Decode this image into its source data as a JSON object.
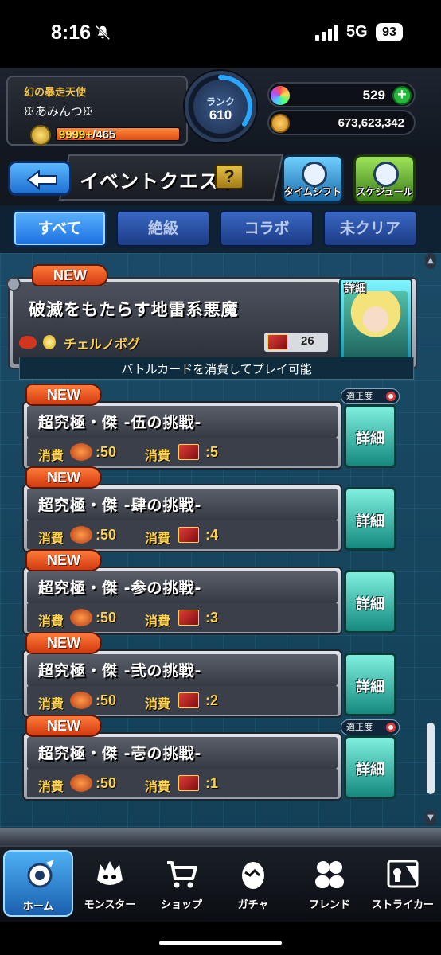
{
  "status_bar": {
    "time": "8:16",
    "network": "5G",
    "battery": "93"
  },
  "player": {
    "title": "幻の暴走天使",
    "name": "ꕥあみんつꕥ",
    "exp_text": "9999+",
    "exp_max": "/465",
    "exp_fraction": 1.0,
    "rank_label": "ランク",
    "rank_value": "610",
    "rank_progress": 0.35
  },
  "currency": {
    "gems": "529",
    "gold": "673,623,342"
  },
  "title_bar": {
    "title": "イベントクエスト",
    "help": "?",
    "timeshift_label": "タイムシフト",
    "schedule_label": "スケジュール"
  },
  "tabs": [
    {
      "label": "すべて",
      "active": true
    },
    {
      "label": "絶級",
      "active": false
    },
    {
      "label": "コラボ",
      "active": false
    },
    {
      "label": "未クリア",
      "active": false
    }
  ],
  "featured": {
    "badge": "NEW",
    "title": "破滅をもたらす地雷系悪魔",
    "boss_name": "チェルノボグ",
    "cards": "26",
    "detail_label": "詳細",
    "note": "バトルカードを消費してプレイ可能"
  },
  "quests": [
    {
      "badge": "NEW",
      "title": "超究極・傑 -伍の挑戦-",
      "cost_label": "消費",
      "stamina_label": "スタミナ",
      "stamina": ":50",
      "card_cost": ":5",
      "detail_label": "詳細",
      "suitability": "適正度",
      "show_suit": true
    },
    {
      "badge": "NEW",
      "title": "超究極・傑 -肆の挑戦-",
      "cost_label": "消費",
      "stamina_label": "スタミナ",
      "stamina": ":50",
      "card_cost": ":4",
      "detail_label": "詳細",
      "suitability": "",
      "show_suit": false
    },
    {
      "badge": "NEW",
      "title": "超究極・傑 -参の挑戦-",
      "cost_label": "消費",
      "stamina_label": "スタミナ",
      "stamina": ":50",
      "card_cost": ":3",
      "detail_label": "詳細",
      "suitability": "",
      "show_suit": false
    },
    {
      "badge": "NEW",
      "title": "超究極・傑 -弐の挑戦-",
      "cost_label": "消費",
      "stamina_label": "スタミナ",
      "stamina": ":50",
      "card_cost": ":2",
      "detail_label": "詳細",
      "suitability": "",
      "show_suit": false
    },
    {
      "badge": "NEW",
      "title": "超究極・傑 -壱の挑戦-",
      "cost_label": "消費",
      "stamina_label": "スタミナ",
      "stamina": ":50",
      "card_cost": ":1",
      "detail_label": "詳細",
      "suitability": "適正度",
      "show_suit": true
    }
  ],
  "nav": [
    {
      "label": "ホーム",
      "icon": "home-icon",
      "active": true
    },
    {
      "label": "モンスター",
      "icon": "monster-icon",
      "active": false
    },
    {
      "label": "ショップ",
      "icon": "cart-icon",
      "active": false
    },
    {
      "label": "ガチャ",
      "icon": "gacha-egg-icon",
      "active": false
    },
    {
      "label": "フレンド",
      "icon": "friends-icon",
      "active": false
    },
    {
      "label": "ストライカー",
      "icon": "striker-card-icon",
      "active": false
    }
  ],
  "colors": {
    "accent": "#1b6fe0",
    "new_badge": "#d23a10",
    "detail_button": "#14897d",
    "gold_text": "#ffd24a"
  }
}
